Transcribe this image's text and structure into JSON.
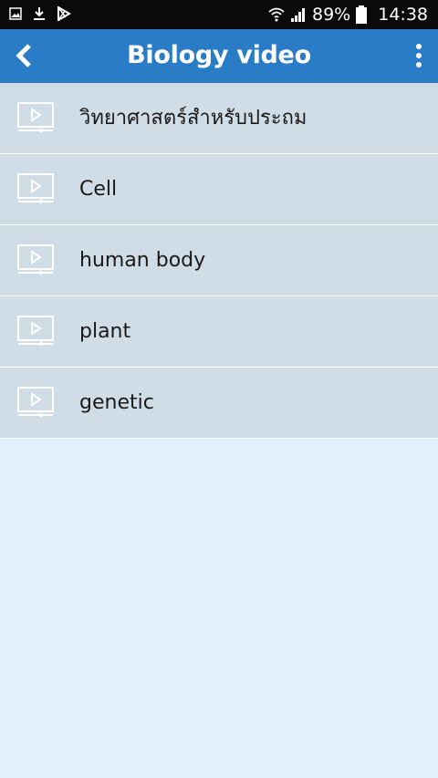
{
  "status_bar": {
    "icons_left": [
      "image-icon",
      "download-icon",
      "play-store-icon"
    ],
    "battery_percent": "89%",
    "time": "14:38",
    "icons_right": [
      "wifi-icon",
      "signal-icon",
      "battery-icon"
    ]
  },
  "app_bar": {
    "title": "Biology video",
    "color": "#2a7cc7"
  },
  "list": {
    "items": [
      {
        "label": "วิทยาศาสตร์สำหรับประถม",
        "icon": "video-icon"
      },
      {
        "label": "Cell",
        "icon": "video-icon"
      },
      {
        "label": "human body",
        "icon": "video-icon"
      },
      {
        "label": "plant",
        "icon": "video-icon"
      },
      {
        "label": "genetic",
        "icon": "video-icon"
      }
    ]
  },
  "colors": {
    "list_item_bg": "#d0dce6",
    "page_bg": "#e1f0fd",
    "status_bar_bg": "#0a0a0a"
  }
}
